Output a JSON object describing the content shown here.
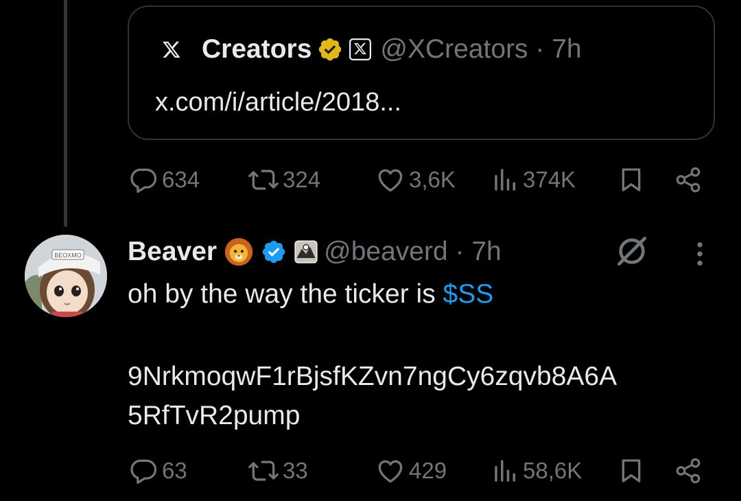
{
  "quote": {
    "name": "Creators",
    "handle": "@XCreators",
    "time": "7h",
    "link": "x.com/i/article/2018..."
  },
  "quote_actions": {
    "replies": "634",
    "reposts": "324",
    "likes": "3,6K",
    "views": "374K"
  },
  "reply": {
    "name": "Beaver",
    "handle": "@beaverd",
    "time": "7h",
    "text": "oh by the way the ticker is ",
    "ticker": "$SS",
    "address_line1": "9NrkmoqwF1rBjsfKZvn7ngCy6zqvb8A6A",
    "address_line2": "5RfTvR2pump",
    "avatar_text": "BEOXMO"
  },
  "reply_actions": {
    "replies": "63",
    "reposts": "33",
    "likes": "429",
    "views": "58,6K"
  },
  "icons": {
    "reply": "reply-icon",
    "repost": "repost-icon",
    "like": "like-icon",
    "views": "views-icon",
    "bookmark": "bookmark-icon",
    "share": "share-icon",
    "gold_badge": "gold-verified-badge-icon",
    "blue_badge": "blue-verified-badge-icon",
    "mute": "mute-icon",
    "more": "more-icon"
  },
  "colors": {
    "background": "#000000",
    "text": "#e7e9ea",
    "muted": "#71767b",
    "link": "#1d9bf0",
    "gold": "#e2b719",
    "border": "#2f3336"
  }
}
